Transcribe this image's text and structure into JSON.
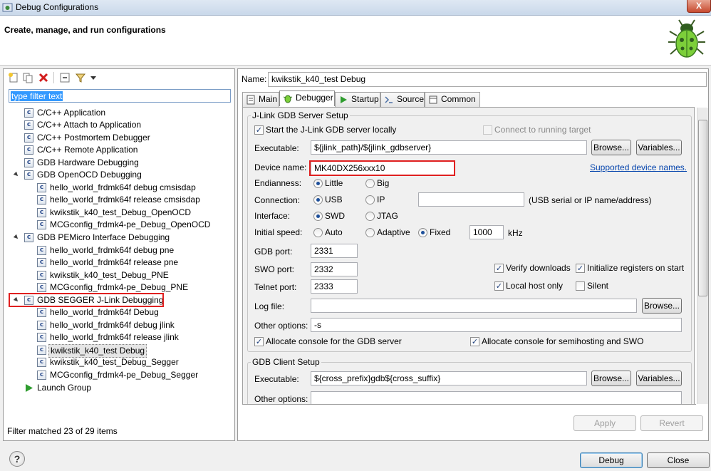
{
  "window": {
    "title": "Debug Configurations",
    "close_label": "X"
  },
  "banner": {
    "title": "Create, manage, and run configurations"
  },
  "filter": {
    "placeholder": "type filter text"
  },
  "tree": [
    {
      "label": "C/C++ Application"
    },
    {
      "label": "C/C++ Attach to Application"
    },
    {
      "label": "C/C++ Postmortem Debugger"
    },
    {
      "label": "C/C++ Remote Application"
    },
    {
      "label": "GDB Hardware Debugging"
    },
    {
      "label": "GDB OpenOCD Debugging"
    },
    {
      "label": "hello_world_frdmk64f debug cmsisdap"
    },
    {
      "label": "hello_world_frdmk64f release cmsisdap"
    },
    {
      "label": "kwikstik_k40_test_Debug_OpenOCD"
    },
    {
      "label": "MCGconfig_frdmk4-pe_Debug_OpenOCD"
    },
    {
      "label": "GDB PEMicro Interface Debugging"
    },
    {
      "label": "hello_world_frdmk64f debug pne"
    },
    {
      "label": "hello_world_frdmk64f release pne"
    },
    {
      "label": "kwikstik_k40_test_Debug_PNE"
    },
    {
      "label": "MCGconfig_frdmk4-pe_Debug_PNE"
    },
    {
      "label": "GDB SEGGER J-Link Debugging"
    },
    {
      "label": "hello_world_frdmk64f Debug"
    },
    {
      "label": "hello_world_frdmk64f debug jlink"
    },
    {
      "label": "hello_world_frdmk64f release jlink"
    },
    {
      "label": "kwikstik_k40_test Debug"
    },
    {
      "label": "kwikstik_k40_test_Debug_Segger"
    },
    {
      "label": "MCGconfig_frdmk4-pe_Debug_Segger"
    },
    {
      "label": "Launch Group"
    }
  ],
  "filter_status": "Filter matched 23 of 29 items",
  "config": {
    "name_label": "Name:",
    "name_value": "kwikstik_k40_test Debug",
    "tabs": [
      "Main",
      "Debugger",
      "Startup",
      "Source",
      "Common"
    ]
  },
  "server": {
    "group_title": "J-Link GDB Server Setup",
    "start_locally": "Start the J-Link GDB server locally",
    "connect_running": "Connect to running target",
    "executable_label": "Executable:",
    "executable_value": "${jlink_path}/${jlink_gdbserver}",
    "browse": "Browse...",
    "variables": "Variables...",
    "device_label": "Device name:",
    "device_value": "MK40DX256xxx10",
    "supported_link": "Supported device names.",
    "endianness_label": "Endianness:",
    "little": "Little",
    "big": "Big",
    "connection_label": "Connection:",
    "usb": "USB",
    "ip": "IP",
    "ip_hint": "(USB serial or IP name/address)",
    "interface_label": "Interface:",
    "swd": "SWD",
    "jtag": "JTAG",
    "speed_label": "Initial speed:",
    "auto": "Auto",
    "adaptive": "Adaptive",
    "fixed": "Fixed",
    "speed_value": "1000",
    "khz": "kHz",
    "gdb_port_label": "GDB port:",
    "gdb_port": "2331",
    "swo_port_label": "SWO port:",
    "swo_port": "2332",
    "telnet_port_label": "Telnet port:",
    "telnet_port": "2333",
    "verify_downloads": "Verify downloads",
    "init_registers": "Initialize registers on start",
    "local_host_only": "Local host only",
    "silent": "Silent",
    "log_label": "Log file:",
    "other_label": "Other options:",
    "other_value": "-s",
    "alloc_gdb": "Allocate console for the GDB server",
    "alloc_semihost": "Allocate console for semihosting and SWO"
  },
  "client": {
    "group_title": "GDB Client Setup",
    "executable_label": "Executable:",
    "executable_value": "${cross_prefix}gdb${cross_suffix}",
    "other_label": "Other options:"
  },
  "buttons": {
    "apply": "Apply",
    "revert": "Revert",
    "debug": "Debug",
    "close": "Close"
  }
}
